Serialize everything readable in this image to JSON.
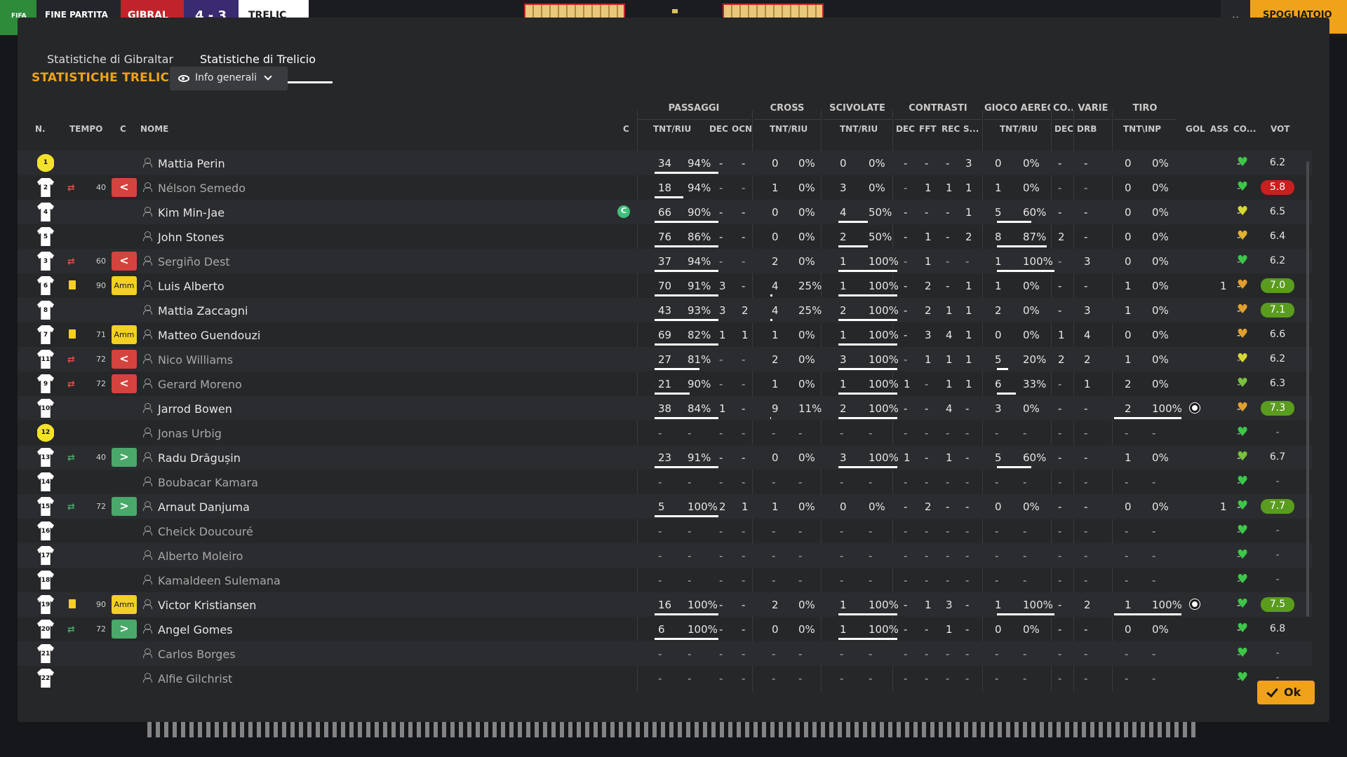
{
  "topbar": {
    "badge": "FIFA",
    "status": "FINE PARTITA",
    "home": "GIBRAL",
    "score": "4 - 3",
    "away": "TRELIC",
    "action": "SPOGLIATOIO"
  },
  "tabs": [
    {
      "label": "Statistiche di Gibraltar"
    },
    {
      "label": "Statistiche di Trelicio"
    }
  ],
  "section": {
    "title": "STATISTICHE TRELICIO",
    "view_label": "Info generali"
  },
  "group_headers": [
    "PASSAGGI",
    "CROSS",
    "SCIVOLATE",
    "CONTRASTI",
    "GIOCO AEREO",
    "CO...",
    "VARIE",
    "TIRO"
  ],
  "col_headers": {
    "n": "N.",
    "tempo": "TEMPO",
    "c": "C",
    "nome": "NOME",
    "c2": "C",
    "pass": "TNT/RIU",
    "pass_dec": "DEC",
    "pass_ocn": "OCN",
    "cross": "TNT/RIU",
    "sciv": "TNT/RIU",
    "con_dec": "DEC",
    "con_fft": "FFT",
    "con_rec": "REC",
    "con_s": "S...",
    "aereo": "TNT/RIU",
    "co_dec": "DEC",
    "varie_drb": "DRB",
    "tiro": "TNT\\INP",
    "gol": "GOL",
    "ass": "ASS",
    "co": "CO...",
    "vot": "VOT"
  },
  "players": [
    {
      "n": "1",
      "gk": true,
      "sub": "",
      "time": "",
      "badge": "",
      "name": "Mattia Perin",
      "dim": false,
      "cap": false,
      "stats": [
        "34",
        "94%",
        "-",
        "-",
        "0",
        "0%",
        "0",
        "0%",
        "-",
        "-",
        "-",
        "3",
        "0",
        "0%",
        "-",
        "-",
        "0",
        "0%",
        "",
        "-"
      ],
      "bars": [
        1,
        0,
        0,
        0,
        0
      ],
      "goal": false,
      "heart": "#3ec64a",
      "vote": "6.2",
      "vc": "none"
    },
    {
      "n": "2",
      "gk": false,
      "sub": "out",
      "time": "40",
      "badge": "out",
      "name": "Nélson Semedo",
      "dim": true,
      "cap": false,
      "stats": [
        "18",
        "94%",
        "-",
        "-",
        "1",
        "0%",
        "3",
        "0%",
        "-",
        "1",
        "1",
        "1",
        "1",
        "0%",
        "-",
        "-",
        "0",
        "0%",
        "",
        "-"
      ],
      "bars": [
        0.45,
        0,
        0,
        0,
        0
      ],
      "goal": false,
      "heart": "#3ec64a",
      "vote": "5.8",
      "vc": "red"
    },
    {
      "n": "4",
      "gk": false,
      "sub": "",
      "time": "",
      "badge": "",
      "name": "Kim Min-Jae",
      "dim": false,
      "cap": true,
      "stats": [
        "66",
        "90%",
        "-",
        "-",
        "0",
        "0%",
        "4",
        "50%",
        "-",
        "-",
        "-",
        "1",
        "5",
        "60%",
        "-",
        "-",
        "0",
        "0%",
        "",
        "-"
      ],
      "bars": [
        1,
        0,
        0.5,
        0.6,
        0
      ],
      "goal": false,
      "heart": "#d8d834",
      "vote": "6.5",
      "vc": "none"
    },
    {
      "n": "5",
      "gk": false,
      "sub": "",
      "time": "",
      "badge": "",
      "name": "John Stones",
      "dim": false,
      "cap": false,
      "stats": [
        "76",
        "86%",
        "-",
        "-",
        "0",
        "0%",
        "2",
        "50%",
        "-",
        "1",
        "-",
        "2",
        "8",
        "87%",
        "2",
        "-",
        "0",
        "0%",
        "",
        "-"
      ],
      "bars": [
        1,
        0,
        0.5,
        0.87,
        0
      ],
      "goal": false,
      "heart": "#e0b030",
      "vote": "6.4",
      "vc": "none"
    },
    {
      "n": "3",
      "gk": false,
      "sub": "out",
      "time": "60",
      "badge": "out",
      "name": "Sergiño Dest",
      "dim": true,
      "cap": false,
      "stats": [
        "37",
        "94%",
        "-",
        "-",
        "2",
        "0%",
        "1",
        "100%",
        "-",
        "1",
        "-",
        "-",
        "1",
        "100%",
        "-",
        "3",
        "0",
        "0%",
        "",
        "-"
      ],
      "bars": [
        1,
        0,
        1,
        1,
        0
      ],
      "goal": false,
      "heart": "#3ec64a",
      "vote": "6.2",
      "vc": "none"
    },
    {
      "n": "6",
      "gk": false,
      "sub": "card",
      "time": "90",
      "badge": "amm",
      "name": "Luis Alberto",
      "dim": false,
      "cap": false,
      "stats": [
        "70",
        "91%",
        "3",
        "-",
        "4",
        "25%",
        "1",
        "100%",
        "-",
        "2",
        "-",
        "1",
        "1",
        "0%",
        "-",
        "-",
        "1",
        "0%",
        "1",
        "-"
      ],
      "bars": [
        1,
        0.25,
        1,
        0,
        0
      ],
      "goal": false,
      "heart": "#e0a030",
      "vote": "7.0",
      "vc": "green"
    },
    {
      "n": "8",
      "gk": false,
      "sub": "",
      "time": "",
      "badge": "",
      "name": "Mattia Zaccagni",
      "dim": false,
      "cap": false,
      "stats": [
        "43",
        "93%",
        "3",
        "2",
        "4",
        "25%",
        "2",
        "100%",
        "-",
        "2",
        "1",
        "1",
        "2",
        "0%",
        "-",
        "3",
        "1",
        "0%",
        "",
        "-"
      ],
      "bars": [
        1,
        0.25,
        1,
        0,
        0
      ],
      "goal": false,
      "heart": "#e0a030",
      "vote": "7.1",
      "vc": "green"
    },
    {
      "n": "7",
      "gk": false,
      "sub": "card",
      "time": "71",
      "badge": "amm",
      "name": "Matteo Guendouzi",
      "dim": false,
      "cap": false,
      "stats": [
        "69",
        "82%",
        "1",
        "1",
        "1",
        "0%",
        "1",
        "100%",
        "-",
        "3",
        "4",
        "1",
        "0",
        "0%",
        "1",
        "4",
        "0",
        "0%",
        "",
        "-"
      ],
      "bars": [
        1,
        0,
        1,
        0,
        0
      ],
      "goal": false,
      "heart": "#e0a030",
      "vote": "6.6",
      "vc": "none"
    },
    {
      "n": "11",
      "gk": false,
      "sub": "out",
      "time": "72",
      "badge": "out",
      "name": "Nico Williams",
      "dim": true,
      "cap": false,
      "stats": [
        "27",
        "81%",
        "-",
        "-",
        "2",
        "0%",
        "3",
        "100%",
        "-",
        "1",
        "1",
        "1",
        "5",
        "20%",
        "2",
        "2",
        "1",
        "0%",
        "",
        "-"
      ],
      "bars": [
        0.7,
        0,
        1,
        0.2,
        0
      ],
      "goal": false,
      "heart": "#d8d834",
      "vote": "6.2",
      "vc": "none"
    },
    {
      "n": "9",
      "gk": false,
      "sub": "out",
      "time": "72",
      "badge": "out",
      "name": "Gerard Moreno",
      "dim": true,
      "cap": false,
      "stats": [
        "21",
        "90%",
        "-",
        "-",
        "1",
        "0%",
        "1",
        "100%",
        "1",
        "-",
        "1",
        "1",
        "6",
        "33%",
        "-",
        "1",
        "2",
        "0%",
        "",
        "-"
      ],
      "bars": [
        0.55,
        0,
        1,
        0.33,
        0
      ],
      "goal": false,
      "heart": "#78c040",
      "vote": "6.3",
      "vc": "none"
    },
    {
      "n": "10",
      "gk": false,
      "sub": "",
      "time": "",
      "badge": "",
      "name": "Jarrod Bowen",
      "dim": false,
      "cap": false,
      "stats": [
        "38",
        "84%",
        "1",
        "-",
        "9",
        "11%",
        "2",
        "100%",
        "-",
        "-",
        "4",
        "-",
        "3",
        "0%",
        "-",
        "-",
        "2",
        "100%",
        "",
        "-"
      ],
      "bars": [
        1,
        0.11,
        1,
        0,
        1
      ],
      "goal": true,
      "heart": "#e0a030",
      "vote": "7.3",
      "vc": "green"
    },
    {
      "n": "12",
      "gk": true,
      "sub": "",
      "time": "",
      "badge": "",
      "name": "Jonas Urbig",
      "dim": true,
      "cap": false,
      "stats": [
        "-",
        "-",
        "-",
        "-",
        "-",
        "-",
        "-",
        "-",
        "-",
        "-",
        "-",
        "-",
        "-",
        "-",
        "-",
        "-",
        "-",
        "-",
        "",
        "-"
      ],
      "bars": [
        0,
        0,
        0,
        0,
        0
      ],
      "goal": false,
      "heart": "#3ec64a",
      "vote": "-",
      "vc": "dash"
    },
    {
      "n": "13",
      "gk": false,
      "sub": "in",
      "time": "40",
      "badge": "in",
      "name": "Radu Drăgușin",
      "dim": false,
      "cap": false,
      "stats": [
        "23",
        "91%",
        "-",
        "-",
        "0",
        "0%",
        "3",
        "100%",
        "1",
        "-",
        "1",
        "-",
        "5",
        "60%",
        "-",
        "-",
        "1",
        "0%",
        "",
        "-"
      ],
      "bars": [
        1,
        0,
        1,
        0.6,
        0
      ],
      "goal": false,
      "heart": "#78c040",
      "vote": "6.7",
      "vc": "none"
    },
    {
      "n": "14",
      "gk": false,
      "sub": "",
      "time": "",
      "badge": "",
      "name": "Boubacar Kamara",
      "dim": true,
      "cap": false,
      "stats": [
        "-",
        "-",
        "-",
        "-",
        "-",
        "-",
        "-",
        "-",
        "-",
        "-",
        "-",
        "-",
        "-",
        "-",
        "-",
        "-",
        "-",
        "-",
        "",
        "-"
      ],
      "bars": [
        0,
        0,
        0,
        0,
        0
      ],
      "goal": false,
      "heart": "#3ec64a",
      "vote": "-",
      "vc": "dash"
    },
    {
      "n": "15",
      "gk": false,
      "sub": "in",
      "time": "72",
      "badge": "in",
      "name": "Arnaut Danjuma",
      "dim": false,
      "cap": false,
      "stats": [
        "5",
        "100%",
        "2",
        "1",
        "1",
        "0%",
        "0",
        "0%",
        "-",
        "2",
        "-",
        "-",
        "0",
        "0%",
        "-",
        "-",
        "0",
        "0%",
        "1",
        "-"
      ],
      "bars": [
        1,
        0,
        0,
        0,
        0
      ],
      "goal": false,
      "heart": "#3ec64a",
      "vote": "7.7",
      "vc": "green"
    },
    {
      "n": "16",
      "gk": false,
      "sub": "",
      "time": "",
      "badge": "",
      "name": "Cheick Doucouré",
      "dim": true,
      "cap": false,
      "stats": [
        "-",
        "-",
        "-",
        "-",
        "-",
        "-",
        "-",
        "-",
        "-",
        "-",
        "-",
        "-",
        "-",
        "-",
        "-",
        "-",
        "-",
        "-",
        "",
        "-"
      ],
      "bars": [
        0,
        0,
        0,
        0,
        0
      ],
      "goal": false,
      "heart": "#3ec64a",
      "vote": "-",
      "vc": "dash"
    },
    {
      "n": "17",
      "gk": false,
      "sub": "",
      "time": "",
      "badge": "",
      "name": "Alberto Moleiro",
      "dim": true,
      "cap": false,
      "stats": [
        "-",
        "-",
        "-",
        "-",
        "-",
        "-",
        "-",
        "-",
        "-",
        "-",
        "-",
        "-",
        "-",
        "-",
        "-",
        "-",
        "-",
        "-",
        "",
        "-"
      ],
      "bars": [
        0,
        0,
        0,
        0,
        0
      ],
      "goal": false,
      "heart": "#3ec64a",
      "vote": "-",
      "vc": "dash"
    },
    {
      "n": "18",
      "gk": false,
      "sub": "",
      "time": "",
      "badge": "",
      "name": "Kamaldeen Sulemana",
      "dim": true,
      "cap": false,
      "stats": [
        "-",
        "-",
        "-",
        "-",
        "-",
        "-",
        "-",
        "-",
        "-",
        "-",
        "-",
        "-",
        "-",
        "-",
        "-",
        "-",
        "-",
        "-",
        "",
        "-"
      ],
      "bars": [
        0,
        0,
        0,
        0,
        0
      ],
      "goal": false,
      "heart": "#3ec64a",
      "vote": "-",
      "vc": "dash"
    },
    {
      "n": "19",
      "gk": false,
      "sub": "card",
      "time": "90",
      "badge": "amm",
      "name": "Victor Kristiansen",
      "dim": false,
      "cap": false,
      "stats": [
        "16",
        "100%",
        "-",
        "-",
        "2",
        "0%",
        "1",
        "100%",
        "-",
        "1",
        "3",
        "-",
        "1",
        "100%",
        "-",
        "2",
        "1",
        "100%",
        "",
        "-"
      ],
      "bars": [
        1,
        0,
        1,
        1,
        1
      ],
      "goal": true,
      "heart": "#3ec64a",
      "vote": "7.5",
      "vc": "green"
    },
    {
      "n": "20",
      "gk": false,
      "sub": "in",
      "time": "72",
      "badge": "in",
      "name": "Angel Gomes",
      "dim": false,
      "cap": false,
      "stats": [
        "6",
        "100%",
        "-",
        "-",
        "0",
        "0%",
        "1",
        "100%",
        "-",
        "-",
        "1",
        "-",
        "0",
        "0%",
        "-",
        "-",
        "0",
        "0%",
        "",
        "-"
      ],
      "bars": [
        1,
        0,
        1,
        0,
        0
      ],
      "goal": false,
      "heart": "#3ec64a",
      "vote": "6.8",
      "vc": "none"
    },
    {
      "n": "21",
      "gk": false,
      "sub": "",
      "time": "",
      "badge": "",
      "name": "Carlos Borges",
      "dim": true,
      "cap": false,
      "stats": [
        "-",
        "-",
        "-",
        "-",
        "-",
        "-",
        "-",
        "-",
        "-",
        "-",
        "-",
        "-",
        "-",
        "-",
        "-",
        "-",
        "-",
        "-",
        "",
        "-"
      ],
      "bars": [
        0,
        0,
        0,
        0,
        0
      ],
      "goal": false,
      "heart": "#3ec64a",
      "vote": "-",
      "vc": "dash"
    },
    {
      "n": "22",
      "gk": false,
      "sub": "",
      "time": "",
      "badge": "",
      "name": "Alfie Gilchrist",
      "dim": true,
      "cap": false,
      "stats": [
        "-",
        "-",
        "-",
        "-",
        "-",
        "-",
        "-",
        "-",
        "-",
        "-",
        "-",
        "-",
        "-",
        "-",
        "-",
        "-",
        "-",
        "-",
        "",
        "-"
      ],
      "bars": [
        0,
        0,
        0,
        0,
        0
      ],
      "goal": false,
      "heart": "#3ec64a",
      "vote": "-",
      "vc": "dash"
    }
  ],
  "captain_label": "C",
  "badge_labels": {
    "out": "<",
    "in": ">",
    "amm": "Amm"
  },
  "ok_label": "Ok"
}
